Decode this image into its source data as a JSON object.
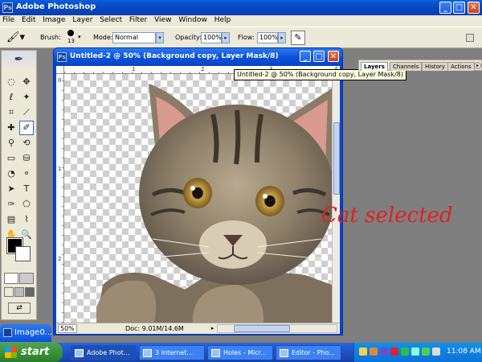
{
  "app": {
    "title": "Adobe Photoshop",
    "icon": "photoshop-icon"
  },
  "window_controls": {
    "minimize": "_",
    "maximize": "□",
    "close": "✕"
  },
  "menu": [
    "File",
    "Edit",
    "Image",
    "Layer",
    "Select",
    "Filter",
    "View",
    "Window",
    "Help"
  ],
  "options": {
    "brush_label": "Brush:",
    "brush_size": "13",
    "mode_label": "Mode:",
    "mode_value": "Normal",
    "opacity_label": "Opacity:",
    "opacity_value": "100%",
    "flow_label": "Flow:",
    "flow_value": "100%"
  },
  "document": {
    "title": "Untitled-2 @ 50% (Background copy, Layer Mask/8)",
    "zoom": "50%",
    "doc_info": "Doc: 9.01M/14.6M",
    "ruler_top_labels": [
      "1",
      "2",
      "3",
      "4"
    ],
    "ruler_left_labels": [
      "0",
      "1",
      "2"
    ]
  },
  "tooltip": "Untitled-2 @ 50% (Background copy, Layer Mask/8)",
  "palette_tabs": [
    "Layers",
    "Channels",
    "History",
    "Actions"
  ],
  "annotation": "Cat selected",
  "minimized_doc": "Image0...",
  "taskbar": {
    "start": "start",
    "tasks": [
      "Adobe Phot...",
      "3 Internet...",
      "Holes - Micr...",
      "Editor - Pho..."
    ],
    "clock": "11:08 AM"
  },
  "colors": {
    "foreground": "#000000",
    "background": "#ffffff",
    "annotation": "#e02020",
    "xp_blue": "#0a52db"
  }
}
